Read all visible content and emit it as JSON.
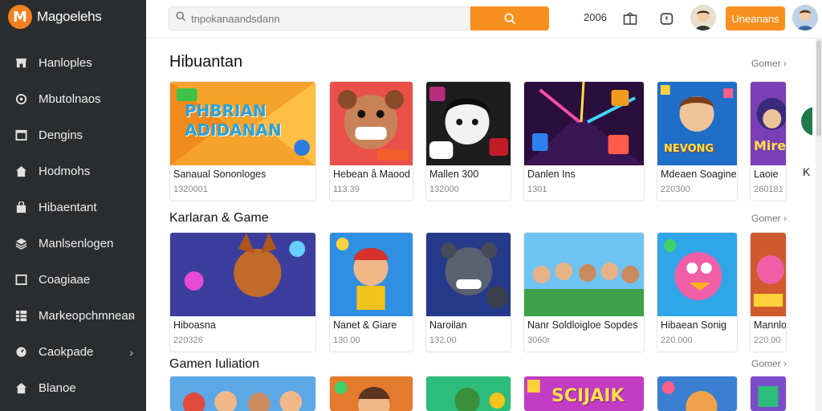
{
  "brand": {
    "name": "Magoelehs",
    "logo_letter": "M"
  },
  "sidebar": {
    "items": [
      {
        "label": "Hanloples",
        "icon": "store-icon"
      },
      {
        "label": "Mbutolnaos",
        "icon": "settings-icon"
      },
      {
        "label": "Dengins",
        "icon": "window-icon"
      },
      {
        "label": "Hodmohs",
        "icon": "home-icon"
      },
      {
        "label": "Hibaentant",
        "icon": "bag-icon"
      },
      {
        "label": "Manlsenlogen",
        "icon": "layers-icon"
      },
      {
        "label": "Coagiaae",
        "icon": "window-icon"
      },
      {
        "label": "Markeopchmnean",
        "icon": "grid-icon",
        "has_chevron": true
      },
      {
        "label": "Caokpade",
        "icon": "gauge-icon",
        "has_chevron": true
      },
      {
        "label": "Blanoe",
        "icon": "home-icon"
      }
    ]
  },
  "header": {
    "search_placeholder": "tnpokanaandsdann",
    "text_item": "2006",
    "cta_label": "Uneanans"
  },
  "sections": [
    {
      "title": "Hibuantan",
      "more": "Gomer",
      "cards": [
        {
          "title": "Sanaual Sononloges",
          "meta": "1320001",
          "bg": "#f6a223",
          "art": "PHBRIAN ADIDANAN"
        },
        {
          "title": "Hebean å Maood",
          "meta": "113.39",
          "bg": "#e9504a",
          "art": ""
        },
        {
          "title": "Mallen 300",
          "meta": "132000",
          "bg": "#1d1d1d",
          "art": ""
        },
        {
          "title": "Danlen Ins",
          "meta": "1301",
          "bg": "#2a0e3c",
          "art": ""
        },
        {
          "title": "Mdeaen Soagined",
          "meta": "220300",
          "bg": "#1f6fc8",
          "art": "NEVONG"
        },
        {
          "title": "Laoie",
          "meta": "260181",
          "bg": "#7a3fb4",
          "art": "Mire"
        }
      ]
    },
    {
      "title": "Karlaran & Game",
      "more": "Gomer",
      "cards": [
        {
          "title": "Hiboasna",
          "meta": "220326",
          "bg": "#3b3e9c",
          "art": ""
        },
        {
          "title": "Nanet & Giare",
          "meta": "130.00",
          "bg": "#2f8fe3",
          "art": ""
        },
        {
          "title": "Naroilan",
          "meta": "132.00",
          "bg": "#253a8a",
          "art": ""
        },
        {
          "title": "Nanr Soldloigloe Sopdes",
          "meta": "3060r",
          "bg": "#3ea14a",
          "art": ""
        },
        {
          "title": "Hibaean Sonig",
          "meta": "220.000",
          "bg": "#2fa6e8",
          "art": ""
        },
        {
          "title": "Mannlo",
          "meta": "220.00",
          "bg": "#d05a2e",
          "art": ""
        }
      ]
    },
    {
      "title": "Gamen Iuliation",
      "more": "Gomer",
      "cards": [
        {
          "title": "",
          "meta": "",
          "bg": "#5ca7e6",
          "art": ""
        },
        {
          "title": "",
          "meta": "",
          "bg": "#e57a2d",
          "art": ""
        },
        {
          "title": "",
          "meta": "",
          "bg": "#2dbd7a",
          "art": ""
        },
        {
          "title": "",
          "meta": "",
          "bg": "#c43cc4",
          "art": "SCIJAIK"
        },
        {
          "title": "",
          "meta": "",
          "bg": "#3a7fd1",
          "art": ""
        },
        {
          "title": "",
          "meta": "",
          "bg": "#7b4cc9",
          "art": ""
        }
      ]
    }
  ],
  "colors": {
    "accent": "#f7901e",
    "sidebar": "#2b2c2e"
  }
}
